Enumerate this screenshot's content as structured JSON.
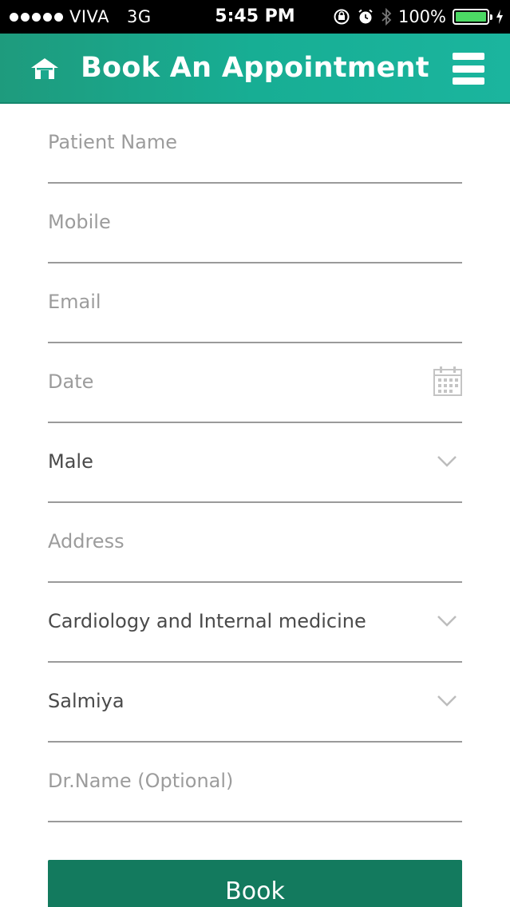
{
  "status_bar": {
    "carrier": "VIVA",
    "network": "3G",
    "time": "5:45 PM",
    "battery": "100%"
  },
  "header": {
    "title": "Book An Appointment",
    "home_icon": "home-icon",
    "menu_icon": "hamburger-menu-icon"
  },
  "form": {
    "patient_name": {
      "placeholder": "Patient Name"
    },
    "mobile": {
      "placeholder": "Mobile"
    },
    "email": {
      "placeholder": "Email"
    },
    "date": {
      "placeholder": "Date"
    },
    "gender": {
      "value": "Male"
    },
    "address": {
      "placeholder": "Address"
    },
    "department": {
      "value": "Cardiology and Internal medicine"
    },
    "location": {
      "value": "Salmiya"
    },
    "doctor": {
      "placeholder": "Dr.Name (Optional)"
    }
  },
  "book_button": {
    "label": "Book"
  },
  "colors": {
    "header": "#17ae94",
    "button": "#137a5e",
    "battery": "#4cd964"
  }
}
